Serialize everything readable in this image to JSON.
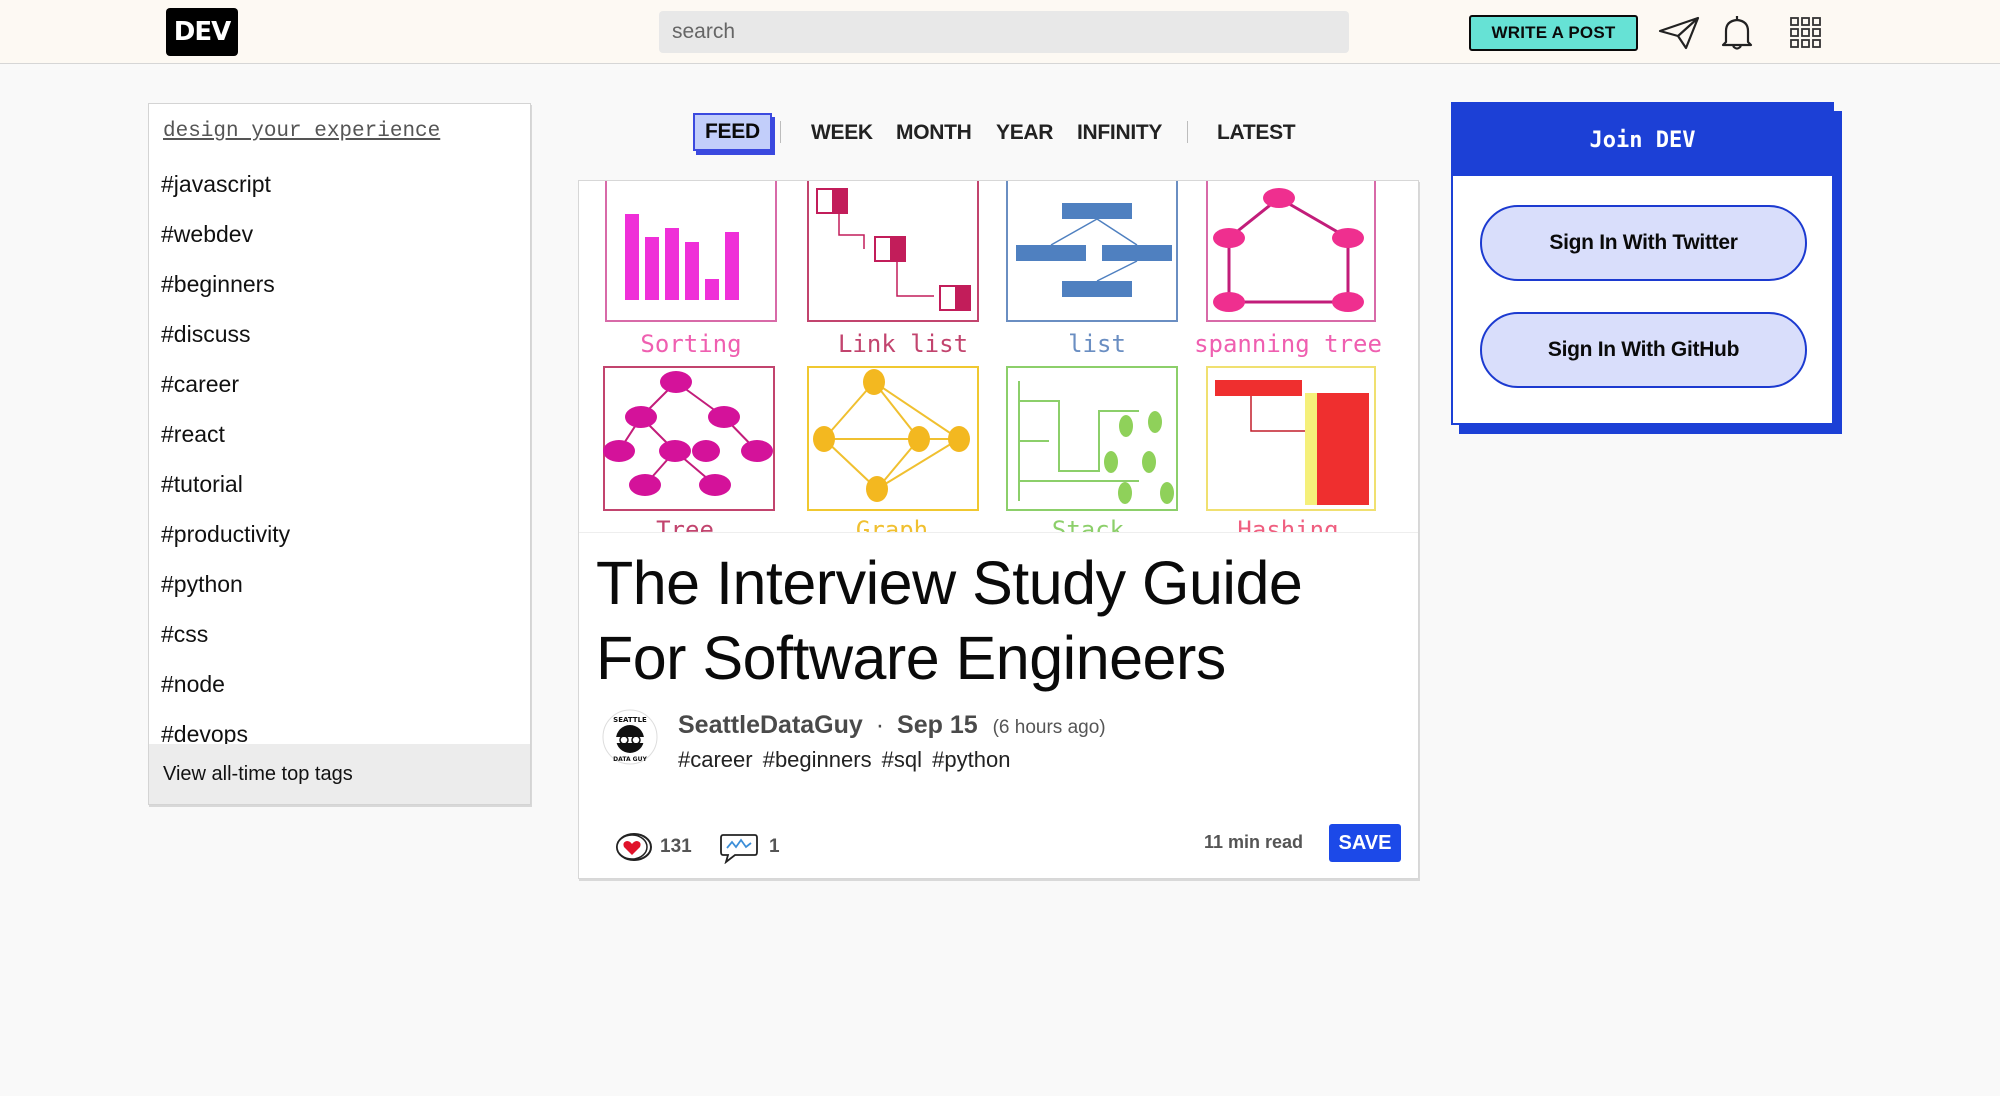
{
  "header": {
    "logo": "DEV",
    "search_placeholder": "search",
    "write_post": "WRITE A POST",
    "icons": [
      "paper-plane-icon",
      "bell-icon",
      "apps-grid-icon"
    ]
  },
  "sidebar": {
    "design_link": "design your experience",
    "tags": [
      "#javascript",
      "#webdev",
      "#beginners",
      "#discuss",
      "#career",
      "#react",
      "#tutorial",
      "#productivity",
      "#python",
      "#css",
      "#node",
      "#devops"
    ],
    "view_all": "View all-time top tags"
  },
  "feed_tabs": [
    "FEED",
    "WEEK",
    "MONTH",
    "YEAR",
    "INFINITY",
    "LATEST"
  ],
  "article": {
    "cover_labels": [
      "Sorting",
      "Link list",
      "list",
      "spanning tree",
      "Tree",
      "Graph",
      "Stack",
      "Hashing"
    ],
    "title": "The Interview Study Guide For Software Engineers",
    "avatar_text": [
      "SEATTLE",
      "DATA GUY"
    ],
    "author": "SeattleDataGuy",
    "separator": "·",
    "date": "Sep 15",
    "relative_time": "(6 hours ago)",
    "tags": "#career #beginners #sql #python",
    "reactions_count": "131",
    "comments_count": "1",
    "read_time": "11 min read",
    "save_label": "SAVE"
  },
  "join": {
    "title": "Join DEV",
    "twitter": "Sign In With Twitter",
    "github": "Sign In With GitHub"
  },
  "colors": {
    "accent": "#1c40d6",
    "write_btn": "#66e2d5",
    "save_btn": "#1c49e8"
  }
}
